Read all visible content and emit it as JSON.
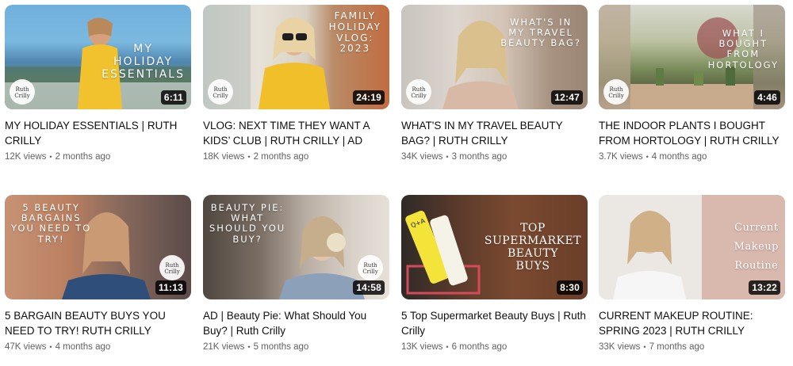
{
  "videos": [
    {
      "title": "MY HOLIDAY ESSENTIALS | RUTH CRILLY",
      "views": "12K views",
      "age": "2 months ago",
      "duration": "6:11",
      "overlay": "MY\nHOLIDAY\nESSENTIALS",
      "logo": "Ruth Crilly"
    },
    {
      "title": "VLOG: NEXT TIME THEY WANT A KIDS’ CLUB | RUTH CRILLY | AD",
      "views": "18K views",
      "age": "2 months ago",
      "duration": "24:19",
      "overlay": "FAMILY\nHOLIDAY\nVLOG:\n2023",
      "logo": "Ruth Crilly"
    },
    {
      "title": "WHAT'S IN MY TRAVEL BEAUTY BAG? | RUTH CRILLY",
      "views": "34K views",
      "age": "3 months ago",
      "duration": "12:47",
      "overlay": "WHAT'S IN\nMY TRAVEL\nBEAUTY BAG?",
      "logo": "Ruth Crilly"
    },
    {
      "title": "THE INDOOR PLANTS I BOUGHT FROM HORTOLOGY | RUTH CRILLY",
      "views": "3.7K views",
      "age": "4 months ago",
      "duration": "4:46",
      "overlay": "WHAT I\nBOUGHT\nFROM\nHORTOLOGY",
      "logo": "Ruth Crilly"
    },
    {
      "title": "5 BARGAIN BEAUTY BUYS YOU NEED TO TRY! RUTH CRILLY",
      "views": "47K views",
      "age": "4 months ago",
      "duration": "11:13",
      "overlay": "5 BEAUTY\nBARGAINS\nYOU NEED TO\nTRY!",
      "logo": "Ruth Crilly"
    },
    {
      "title": "AD | Beauty Pie: What Should You Buy? | Ruth Crilly",
      "views": "21K views",
      "age": "5 months ago",
      "duration": "14:58",
      "overlay": "BEAUTY PIE:\nWHAT\nSHOULD YOU\nBUY?",
      "logo": "Ruth Crilly"
    },
    {
      "title": "5 Top Supermarket Beauty Buys | Ruth Crilly",
      "views": "13K views",
      "age": "6 months ago",
      "duration": "8:30",
      "overlay": "TOP\nSUPERMARKET\nBEAUTY\nBUYS",
      "product": "Q+A",
      "logo": ""
    },
    {
      "title": "CURRENT MAKEUP ROUTINE: SPRING 2023 | RUTH CRILLY",
      "views": "33K views",
      "age": "7 months ago",
      "duration": "13:22",
      "overlay": "Current\nMakeup\nRoutine",
      "logo": ""
    }
  ],
  "separator": "•",
  "colors": {
    "title": "#0f0f0f",
    "meta": "#606060",
    "duration_bg": "#000000"
  }
}
